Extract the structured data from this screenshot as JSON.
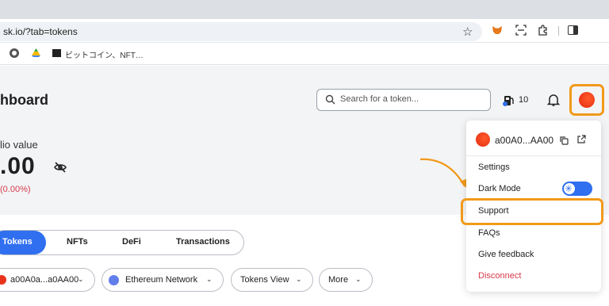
{
  "browser": {
    "url": "sk.io/?tab=tokens",
    "bookmark": "ビットコイン、NFT…"
  },
  "dashboard": {
    "title": "hboard",
    "portfolio_label": "lio value",
    "portfolio_value": ".00",
    "change": "(0.00%)"
  },
  "header": {
    "search_placeholder": "Search for a token...",
    "gas_count": "10"
  },
  "account_menu": {
    "account_name": "a00A0...AA00",
    "items": [
      "Settings",
      "Dark Mode",
      "Support",
      "FAQs",
      "Give feedback",
      "Disconnect"
    ],
    "dark_mode_enabled": true
  },
  "tabs": [
    "Tokens",
    "NFTs",
    "DeFi",
    "Transactions"
  ],
  "filters": {
    "account": "a00A0a...a0AA00",
    "network": "Ethereum Network",
    "view": "Tokens View",
    "more": "More"
  },
  "colors": {
    "highlight": "#f19a1a",
    "primary": "#2f6ff0",
    "danger": "#d73a49",
    "avatar": "#e8331a"
  }
}
